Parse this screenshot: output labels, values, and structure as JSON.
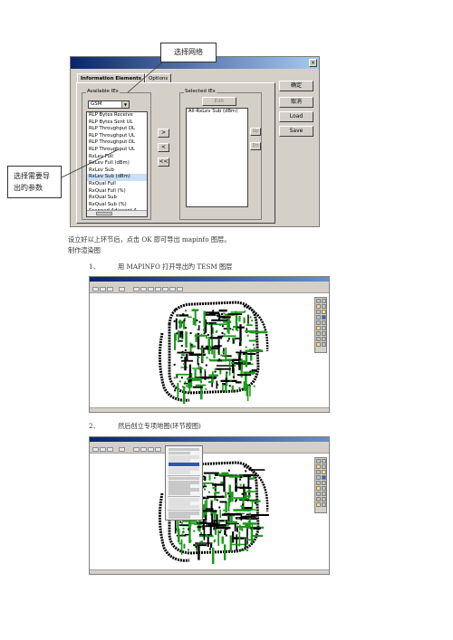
{
  "dialog": {
    "tabs": [
      {
        "label": "Information Elements",
        "active": true
      },
      {
        "label": "Options",
        "active": false
      }
    ],
    "available_label": "Available IEs",
    "selected_label": "Selected IEs",
    "combo_value": "GSM",
    "available_items": [
      "RLP Bytes Receive",
      "RLP Bytes Sent UL",
      "RLP Throughput DL",
      "RLP Throughput UL",
      "RLP Throughput DL",
      "RLP Throughput UL",
      "RxLev Full",
      "RxLev Full (dBm)",
      "RxLev Sub",
      "RxLev Sub (dBm)",
      "RxQual Full",
      "RxQual Full (%)",
      "RxQual Sub",
      "RxQual Sub (%)",
      "Scanned Adjacent A"
    ],
    "selected_index": 9,
    "selected_items": [
      "All-RxLev Sub (dBm)"
    ],
    "edit_label": "Edit",
    "move_right": ">",
    "move_left": "<",
    "move_all_left": "<<",
    "up_label": "Up",
    "down_label": "Dn",
    "buttons": {
      "ok": "确定",
      "cancel": "取消",
      "load": "Load",
      "save": "Save"
    }
  },
  "callouts": {
    "top": "选择网络",
    "left": "选择需要导出旳参数"
  },
  "text": {
    "line1": "设立好以上环节后，点击 OK 即可导出 mapinfo 图层。",
    "line2": "制作渲染图",
    "step1_num": "1、",
    "step1_text": "用 MAPINFO 打开导出旳 TESM 图层",
    "step2_num": "2、",
    "step2_text": "然后创立专项地图(环节按图)"
  },
  "colors": {
    "map_green": "#1a9a1a",
    "map_black": "#000000",
    "titlebar": "#0a246a"
  }
}
